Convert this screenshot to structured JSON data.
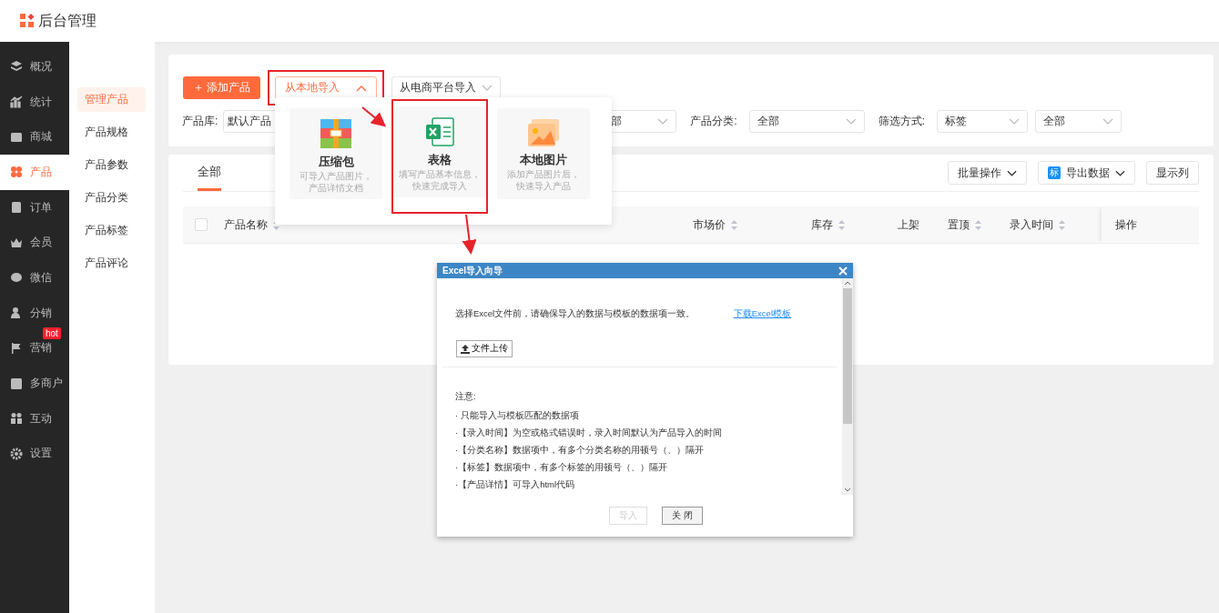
{
  "header": {
    "title": "后台管理"
  },
  "nav": [
    {
      "label": "概况",
      "selected": false
    },
    {
      "label": "统计",
      "selected": false
    },
    {
      "label": "商城",
      "selected": false
    },
    {
      "label": "产品",
      "selected": true
    },
    {
      "label": "订单",
      "selected": false
    },
    {
      "label": "会员",
      "selected": false
    },
    {
      "label": "微信",
      "selected": false
    },
    {
      "label": "分销",
      "selected": false
    },
    {
      "label": "营销",
      "selected": false,
      "badge": "hot"
    },
    {
      "label": "多商户",
      "selected": false
    },
    {
      "label": "互动",
      "selected": false
    },
    {
      "label": "设置",
      "selected": false
    }
  ],
  "subnav": [
    {
      "label": "管理产品",
      "selected": true
    },
    {
      "label": "产品规格",
      "selected": false
    },
    {
      "label": "产品参数",
      "selected": false
    },
    {
      "label": "产品分类",
      "selected": false
    },
    {
      "label": "产品标签",
      "selected": false
    },
    {
      "label": "产品评论",
      "selected": false
    }
  ],
  "toolbar": {
    "add_button": "＋ 添加产品",
    "local_import": {
      "label": "从本地导入",
      "expanded": true,
      "highlighted": true
    },
    "platform_import": {
      "label": "从电商平台导入",
      "expanded": false
    }
  },
  "filters": [
    {
      "label": "产品库:",
      "value": "默认产品"
    },
    {
      "value": "部"
    },
    {
      "label": "产品分类:",
      "value": "全部"
    },
    {
      "label": "筛选方式:",
      "value": "标签"
    },
    {
      "value": "全部"
    }
  ],
  "tabs": [
    {
      "label": "全部",
      "selected": true
    }
  ],
  "actions": [
    {
      "label": "批量操作",
      "kind": "dropdown"
    },
    {
      "label": "导出数据",
      "kind": "tagged",
      "tag": "标"
    },
    {
      "label": "显示列",
      "kind": "plain"
    }
  ],
  "select_all": {
    "checked": false
  },
  "columns": [
    {
      "label": "产品名称",
      "sortable": true
    },
    {
      "label": "市场价",
      "sortable": true
    },
    {
      "label": "库存",
      "sortable": true
    },
    {
      "label": "上架",
      "sortable": false
    },
    {
      "label": "置顶",
      "sortable": true
    },
    {
      "label": "录入时间",
      "sortable": true
    },
    {
      "label": "操作",
      "sortable": false
    }
  ],
  "import_menu": [
    {
      "title": "压缩包",
      "desc": [
        "可导入产品图片，",
        "产品详情文档"
      ],
      "highlighted": false
    },
    {
      "title": "表格",
      "desc": [
        "填写产品基本信息，",
        "快速完成导入"
      ],
      "highlighted": true
    },
    {
      "title": "本地图片",
      "desc": [
        "添加产品图片后，",
        "快速导入产品"
      ],
      "highlighted": false
    }
  ],
  "dialog": {
    "title": "Excel导入向导",
    "intro": "选择Excel文件前，请确保导入的数据与模板的数据项一致。",
    "link": "下载Excel模板",
    "upload": "文件上传",
    "note_title": "注意:",
    "notes": [
      "· 只能导入与模板匹配的数据项",
      "·【录入时间】为空或格式错误时，录入时间默认为产品导入的时间",
      "·【分类名称】数据项中，有多个分类名称的用顿号（、）隔开",
      "·【标签】数据项中，有多个标签的用顿号（、）隔开",
      "·【产品详情】可导入html代码"
    ],
    "buttons": [
      {
        "label": "导入",
        "disabled": true
      },
      {
        "label": "关 闭",
        "disabled": false
      }
    ]
  }
}
